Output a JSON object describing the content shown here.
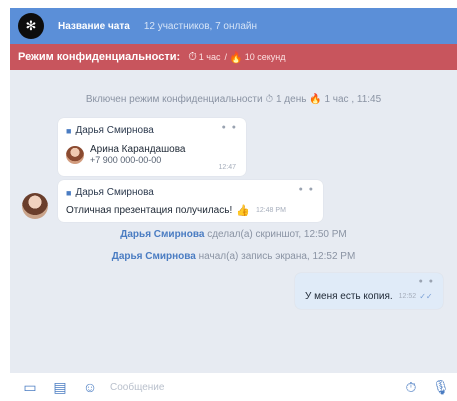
{
  "header": {
    "avatar_glyph": "✻",
    "title": "Название чата",
    "subtitle": "12 участников, 7 онлайн"
  },
  "privacy_bar": {
    "label": "Режим конфиденциальности:",
    "timer_1": "1 час",
    "separator": "/",
    "timer_2": "10 секунд"
  },
  "system_messages": {
    "privacy_enabled": "Включен режим конфиденциальности",
    "privacy_day": "1 день",
    "privacy_hour": "1 час , 11:45",
    "screenshot_name": "Дарья Смирнова",
    "screenshot_action": "сделал(а) скриншот, 12:50 PM",
    "record_name": "Дарья Смирнова",
    "record_action": "начал(а) запись экрана, 12:52 PM"
  },
  "messages": [
    {
      "sender": "Дарья Смирнова",
      "contact_name": "Арина Карандашова",
      "contact_phone": "+7 900 000-00-00",
      "time": "12:47"
    },
    {
      "sender": "Дарья Смирнова",
      "text": "Отличная презентация получилась!",
      "emoji": "👍",
      "time": "12:48 PM"
    },
    {
      "text": "У меня есть копия.",
      "time": "12:52"
    }
  ],
  "composer": {
    "placeholder": "Сообщение"
  }
}
